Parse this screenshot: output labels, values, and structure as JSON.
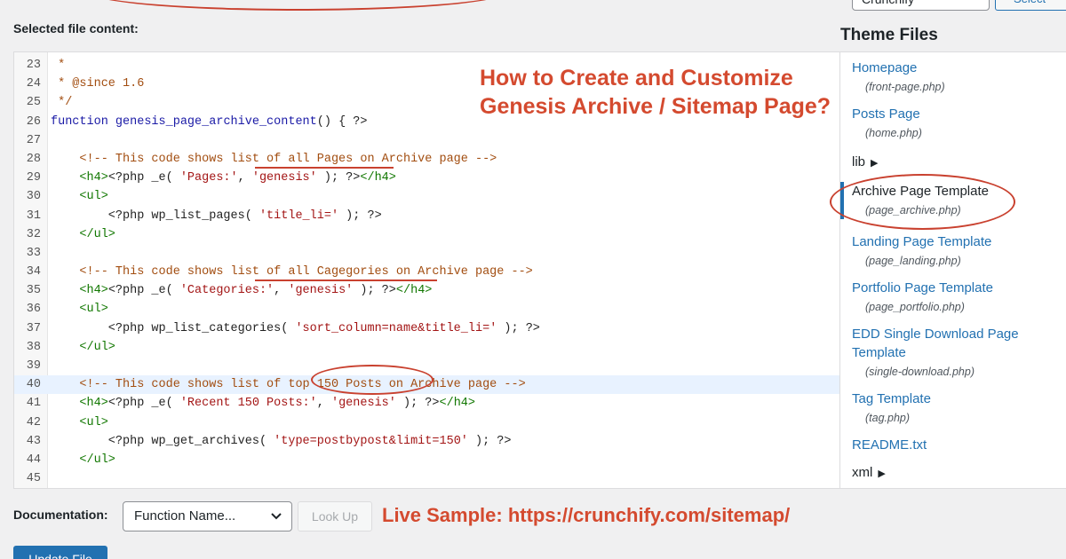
{
  "top": {
    "select_value": "Crunchify",
    "select_button": "Select"
  },
  "editor_label": "Selected file content:",
  "code": [
    {
      "n": "23",
      "parts": [
        {
          "t": " *",
          "c": "comment"
        }
      ]
    },
    {
      "n": "24",
      "parts": [
        {
          "t": " * @since 1.6",
          "c": "comment"
        }
      ]
    },
    {
      "n": "25",
      "parts": [
        {
          "t": " */",
          "c": "comment"
        }
      ]
    },
    {
      "n": "26",
      "parts": [
        {
          "t": "function ",
          "c": "kw"
        },
        {
          "t": "genesis_page_archive_content",
          "c": "fn"
        },
        {
          "t": "() { ?>",
          "c": "plain"
        }
      ]
    },
    {
      "n": "27",
      "parts": []
    },
    {
      "n": "28",
      "parts": [
        {
          "t": "    <!-- This code shows list of all Pages on Archive page -->",
          "c": "comment"
        }
      ]
    },
    {
      "n": "29",
      "parts": [
        {
          "t": "    <h4>",
          "c": "tag"
        },
        {
          "t": "<?php _e( ",
          "c": "plain"
        },
        {
          "t": "'Pages:'",
          "c": "str"
        },
        {
          "t": ", ",
          "c": "plain"
        },
        {
          "t": "'genesis'",
          "c": "str"
        },
        {
          "t": " ); ?>",
          "c": "plain"
        },
        {
          "t": "</h4>",
          "c": "tag"
        }
      ]
    },
    {
      "n": "30",
      "parts": [
        {
          "t": "    <ul>",
          "c": "tag"
        }
      ]
    },
    {
      "n": "31",
      "parts": [
        {
          "t": "        <?php wp_list_pages( ",
          "c": "plain"
        },
        {
          "t": "'title_li='",
          "c": "str"
        },
        {
          "t": " ); ?>",
          "c": "plain"
        }
      ]
    },
    {
      "n": "32",
      "parts": [
        {
          "t": "    </ul>",
          "c": "tag"
        }
      ]
    },
    {
      "n": "33",
      "parts": []
    },
    {
      "n": "34",
      "parts": [
        {
          "t": "    <!-- This code shows list of all Cagegories on Archive page -->",
          "c": "comment"
        }
      ]
    },
    {
      "n": "35",
      "parts": [
        {
          "t": "    <h4>",
          "c": "tag"
        },
        {
          "t": "<?php _e( ",
          "c": "plain"
        },
        {
          "t": "'Categories:'",
          "c": "str"
        },
        {
          "t": ", ",
          "c": "plain"
        },
        {
          "t": "'genesis'",
          "c": "str"
        },
        {
          "t": " ); ?>",
          "c": "plain"
        },
        {
          "t": "</h4>",
          "c": "tag"
        }
      ]
    },
    {
      "n": "36",
      "parts": [
        {
          "t": "    <ul>",
          "c": "tag"
        }
      ]
    },
    {
      "n": "37",
      "parts": [
        {
          "t": "        <?php wp_list_categories( ",
          "c": "plain"
        },
        {
          "t": "'sort_column=name&title_li='",
          "c": "str"
        },
        {
          "t": " ); ?>",
          "c": "plain"
        }
      ]
    },
    {
      "n": "38",
      "parts": [
        {
          "t": "    </ul>",
          "c": "tag"
        }
      ]
    },
    {
      "n": "39",
      "parts": []
    },
    {
      "n": "40",
      "parts": [
        {
          "t": "    <!-- This code shows list of top 150 Posts on Archive page -->",
          "c": "comment"
        }
      ],
      "active": true
    },
    {
      "n": "41",
      "parts": [
        {
          "t": "    <h4>",
          "c": "tag"
        },
        {
          "t": "<?php _e( ",
          "c": "plain"
        },
        {
          "t": "'Recent 150 Posts:'",
          "c": "str"
        },
        {
          "t": ", ",
          "c": "plain"
        },
        {
          "t": "'genesis'",
          "c": "str"
        },
        {
          "t": " ); ?>",
          "c": "plain"
        },
        {
          "t": "</h4>",
          "c": "tag"
        }
      ]
    },
    {
      "n": "42",
      "parts": [
        {
          "t": "    <ul>",
          "c": "tag"
        }
      ]
    },
    {
      "n": "43",
      "parts": [
        {
          "t": "        <?php wp_get_archives( ",
          "c": "plain"
        },
        {
          "t": "'type=postbypost&limit=150'",
          "c": "str"
        },
        {
          "t": " ); ?>",
          "c": "plain"
        }
      ]
    },
    {
      "n": "44",
      "parts": [
        {
          "t": "    </ul>",
          "c": "tag"
        }
      ]
    },
    {
      "n": "45",
      "parts": []
    }
  ],
  "headline": {
    "line1": "How to Create and Customize",
    "line2": "Genesis Archive / Sitemap Page?"
  },
  "theme_files": {
    "title": "Theme Files",
    "homepage": {
      "name": "Homepage",
      "file": "(front-page.php)"
    },
    "posts_page": {
      "name": "Posts Page",
      "file": "(home.php)"
    },
    "lib": "lib",
    "archive": {
      "name": "Archive Page Template",
      "file": "(page_archive.php)"
    },
    "landing": {
      "name": "Landing Page Template",
      "file": "(page_landing.php)"
    },
    "portfolio": {
      "name": "Portfolio Page Template",
      "file": "(page_portfolio.php)"
    },
    "edd": {
      "name_line1": "EDD Single Download Page",
      "name_line2": "Template",
      "file": "(single-download.php)"
    },
    "tag": {
      "name": "Tag Template",
      "file": "(tag.php)"
    },
    "readme": {
      "name": "README.txt"
    },
    "xml": "xml"
  },
  "bottom": {
    "doc_label": "Documentation:",
    "doc_select": "Function Name...",
    "lookup": "Look Up",
    "live_sample": "Live Sample: https://crunchify.com/sitemap/",
    "update_button": "Update File"
  },
  "colors": {
    "accent": "#2271b1",
    "annotation": "#d44a2f"
  }
}
